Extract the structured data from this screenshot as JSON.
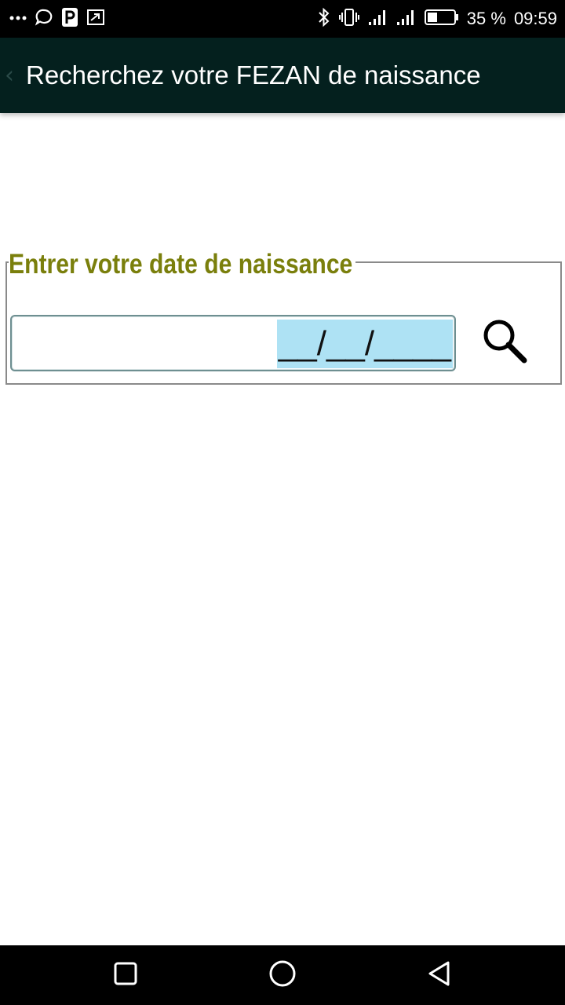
{
  "status_bar": {
    "battery_percent": "35 %",
    "time": "09:59",
    "icons": [
      "more-dots-icon",
      "chat-bubble-icon",
      "p-app-icon",
      "cast-icon",
      "bluetooth-icon",
      "vibrate-icon",
      "signal-icon",
      "signal-icon",
      "battery-icon"
    ]
  },
  "app_bar": {
    "title": "Recherchez votre FEZAN de naissance"
  },
  "form": {
    "legend": "Entrer votre date de naissance",
    "date_mask": "__/__/____",
    "date_value": ""
  },
  "nav_bar": {
    "buttons": [
      "recent-apps-icon",
      "home-icon",
      "back-icon"
    ]
  },
  "colors": {
    "app_bar_bg": "#04201e",
    "legend_text": "#7a7f0c",
    "selection_highlight": "#aee2f4"
  }
}
